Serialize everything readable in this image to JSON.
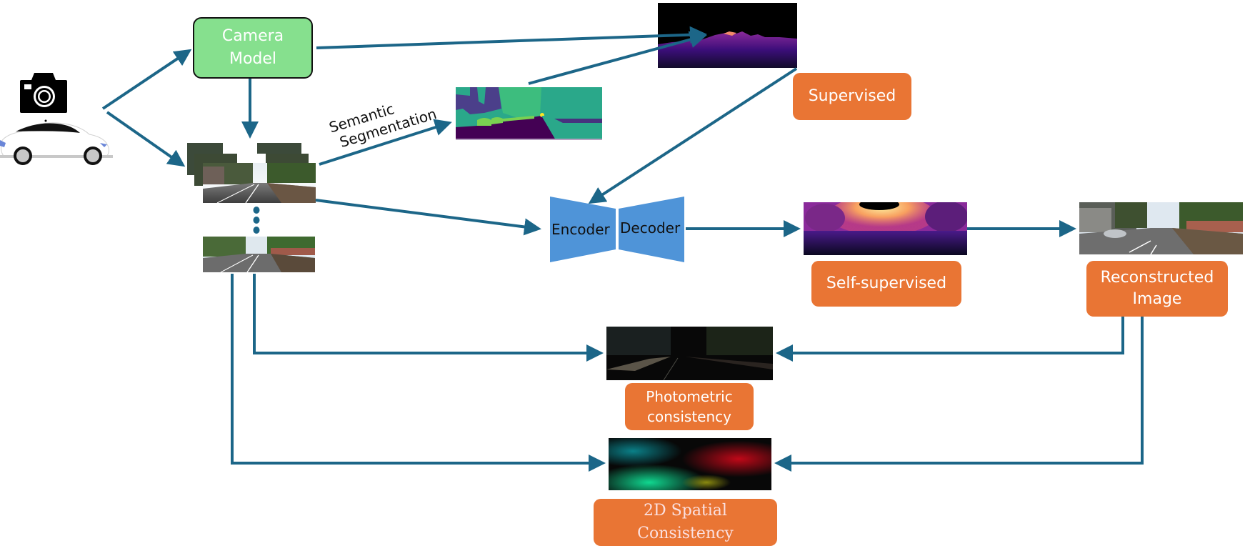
{
  "diagram": {
    "camera_model": {
      "line1": "Camera",
      "line2": "Model"
    },
    "semantic_segmentation": {
      "line1": "Semantic",
      "line2": "Segmentation"
    },
    "encoder_label": "Encoder",
    "decoder_label": "Decoder",
    "labels": {
      "supervised": "Supervised",
      "self_supervised": "Self-supervised",
      "reconstructed": {
        "line1": "Reconstructed",
        "line2": "Image"
      },
      "photometric": {
        "line1": "Photometric",
        "line2": "consistency"
      },
      "spatial": {
        "line1": "2D Spatial",
        "line2": "Consistency"
      }
    },
    "colors": {
      "arrow": "#1c6688",
      "orange_label": "#e97534",
      "green_box": "#86e08e",
      "encoder_decoder": "#4f94d8"
    },
    "icons": [
      "camera-icon",
      "car-icon"
    ],
    "images": [
      "input-frame-stack",
      "input-frame-last",
      "segmentation-map",
      "supervised-depth-map",
      "self-supervised-depth-map",
      "reconstructed-image",
      "photometric-error-map",
      "spatial-consistency-map"
    ]
  }
}
